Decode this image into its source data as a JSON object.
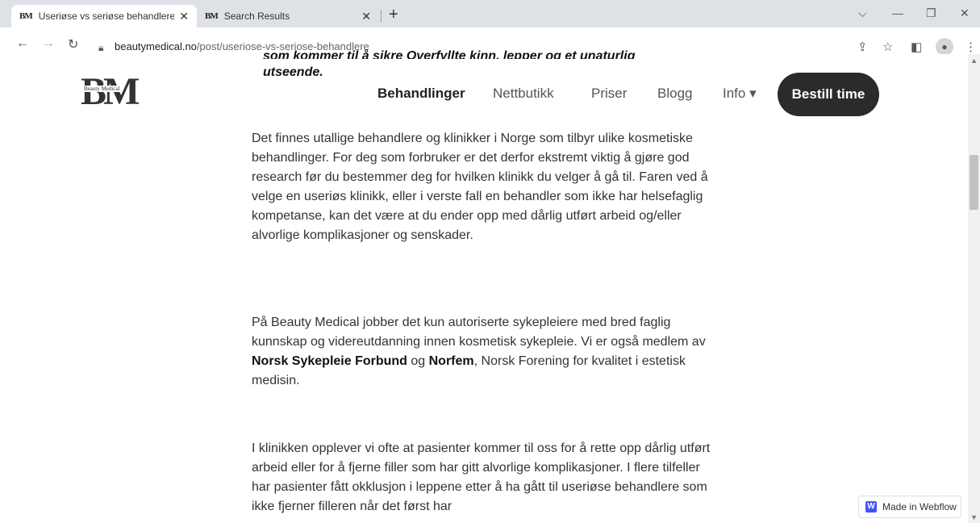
{
  "browser": {
    "tabs": [
      {
        "favicon": "BM",
        "title": "Useriøse vs seriøse behandlere - ",
        "active": true
      },
      {
        "favicon": "BM",
        "title": "Search Results",
        "active": false
      }
    ],
    "new_tab": "+",
    "url_domain": "beautymedical.no",
    "url_path": "/post/useriose-vs-seriose-behandlere"
  },
  "site": {
    "logo_mark": "BM",
    "logo_sub": "Beauty Medical",
    "nav": {
      "behandlinger": "Behandlinger",
      "nettbutikk": "Nettbutikk",
      "priser": "Priser",
      "blogg": "Blogg",
      "info": "Info ▾"
    },
    "cta": "Bestill time"
  },
  "article": {
    "heading_partial_cut": "som kommer til å sikre Overfyllte kinn, lepper og et unaturlig",
    "heading_partial_line2": "utseende.",
    "p1": "Det finnes utallige behandlere og klinikker i Norge som tilbyr ulike kosmetiske behandlinger. For deg som forbruker er det derfor ekstremt viktig å gjøre god research før du bestemmer deg for hvilken klinikk du velger å gå til. Faren ved å velge en useriøs klinikk, eller i verste fall en behandler som ikke har helsefaglig kompetanse, kan det være at du ender opp med dårlig utført arbeid og/eller alvorlige komplikasjoner og senskader.",
    "p2_before": "På Beauty Medical  jobber det kun autoriserte sykepleiere med bred faglig kunnskap og videreutdanning innen kosmetisk sykepleie. Vi er også medlem av ",
    "p2_link1": "Norsk Sykepleie Forbund",
    "p2_mid": " og ",
    "p2_link2": "Norfem",
    "p2_after": ", Norsk Forening for kvalitet i estetisk medisin.",
    "p3": "I klinikken opplever vi ofte at pasienter kommer til oss for å rette opp dårlig utført arbeid eller for å fjerne filler som har gitt alvorlige komplikasjoner. I flere tilfeller har pasienter fått okklusjon i leppene etter å ha gått til useriøse behandlere som ikke fjerner filleren når det først har"
  },
  "badge": {
    "label": "Made in Webflow"
  }
}
